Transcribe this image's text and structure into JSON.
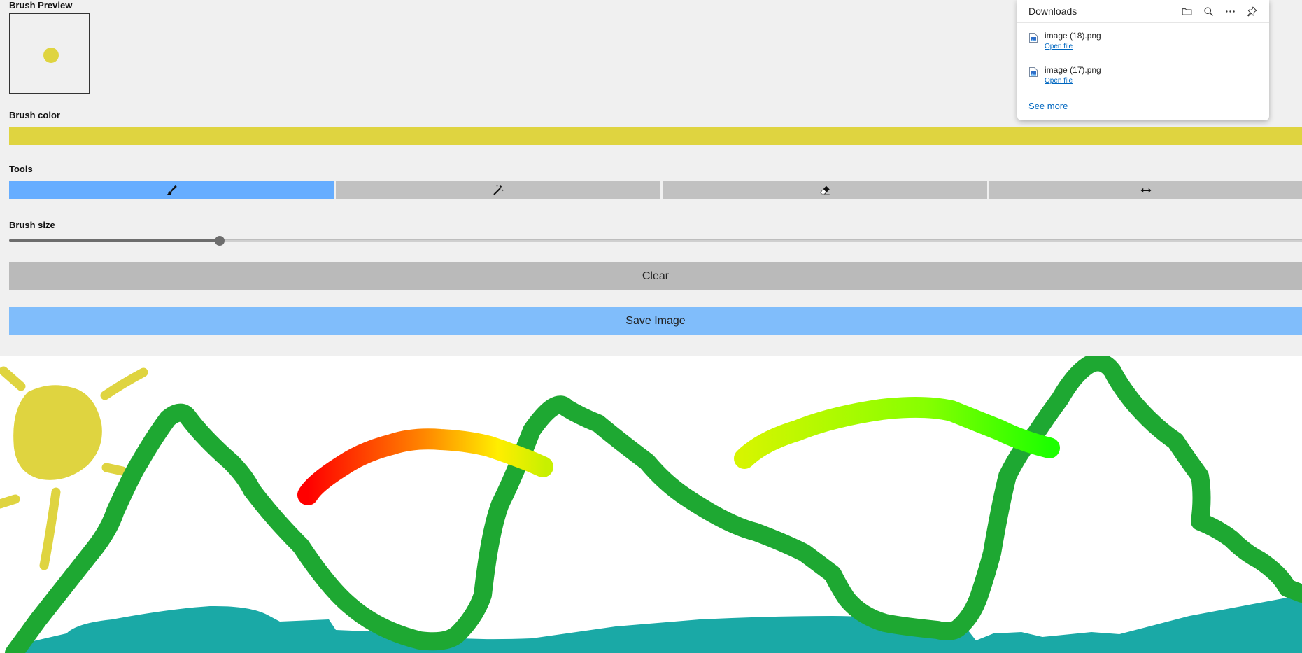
{
  "brush_preview": {
    "label": "Brush Preview"
  },
  "brush_color": {
    "label": "Brush color",
    "value": "#dfd440"
  },
  "tools": {
    "label": "Tools",
    "items": [
      {
        "name": "brush",
        "icon": "brush-icon",
        "active": true
      },
      {
        "name": "magic",
        "icon": "magic-wand-icon",
        "active": false
      },
      {
        "name": "eraser",
        "icon": "eraser-icon",
        "active": false
      },
      {
        "name": "resize",
        "icon": "horizontal-arrows-icon",
        "active": false
      }
    ]
  },
  "brush_size": {
    "label": "Brush size",
    "value_fraction": 0.163
  },
  "buttons": {
    "clear_label": "Clear",
    "save_label": "Save Image"
  },
  "colors": {
    "active_tool": "#66adff",
    "inactive_tool": "#c1c1c1",
    "clear_button": "#bababa",
    "save_button": "#80bdfb",
    "mountain_green": "#1ea832",
    "water_teal": "#1aa9a6",
    "sun_yellow": "#dfd440"
  },
  "downloads": {
    "title": "Downloads",
    "icons": [
      "folder-icon",
      "search-icon",
      "more-icon",
      "pin-icon"
    ],
    "items": [
      {
        "filename": "image (18).png",
        "action": "Open file"
      },
      {
        "filename": "image (17).png",
        "action": "Open file"
      }
    ],
    "see_more": "See more"
  }
}
